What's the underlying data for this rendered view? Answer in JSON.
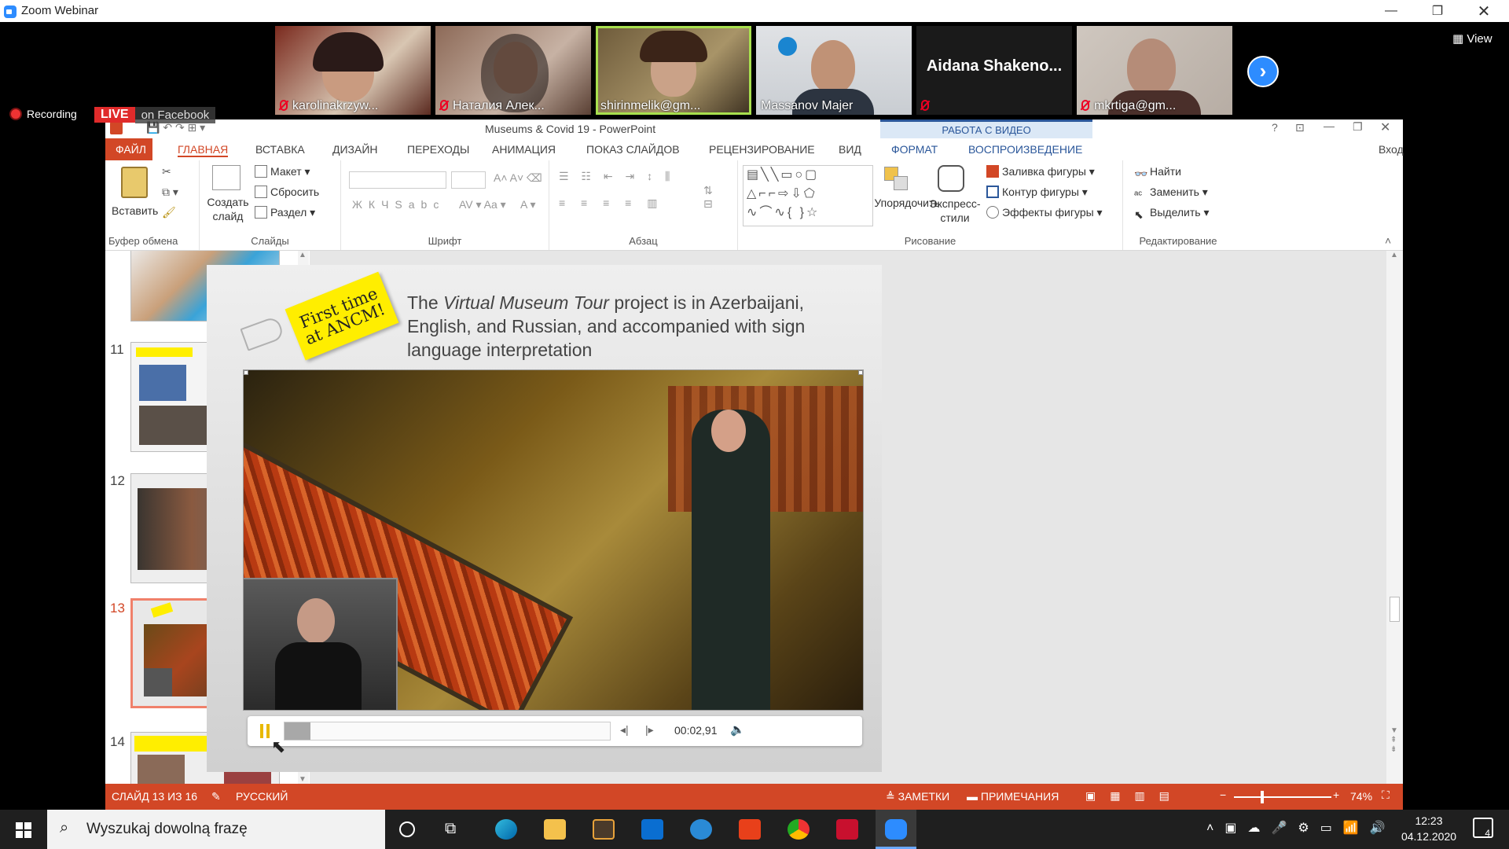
{
  "zoom": {
    "title": "Zoom Webinar",
    "participants": [
      {
        "name": "karolinakrzyw..."
      },
      {
        "name": "Наталия Алек..."
      },
      {
        "name": "shirinmelik@gm..."
      },
      {
        "name": "Massanov Majer"
      },
      {
        "name": "Aidana Shakeno..."
      },
      {
        "name": "mkrtiga@gm..."
      }
    ],
    "view_label": "View",
    "recording_label": "Recording",
    "live_label": "LIVE",
    "live_platform": "on Facebook"
  },
  "ppt": {
    "title": "Museums & Covid 19 - PowerPoint",
    "context_tab_group": "РАБОТА С ВИДЕО",
    "tabs": [
      "ФАЙЛ",
      "ГЛАВНАЯ",
      "ВСТАВКА",
      "ДИЗАЙН",
      "ПЕРЕХОДЫ",
      "АНИМАЦИЯ",
      "ПОКАЗ СЛАЙДОВ",
      "РЕЦЕНЗИРОВАНИЕ",
      "ВИД",
      "ФОРМАТ",
      "ВОСПРОИЗВЕДЕНИЕ"
    ],
    "signin": "Вход",
    "ribbon": {
      "clipboard": {
        "paste": "Вставить",
        "label": "Буфер обмена"
      },
      "slides": {
        "new_slide": "Создать слайд",
        "layout": "Макет",
        "reset": "Сбросить",
        "section": "Раздел",
        "label": "Слайды"
      },
      "font": {
        "label": "Шрифт"
      },
      "paragraph": {
        "label": "Абзац"
      },
      "drawing": {
        "arrange": "Упорядочить",
        "quick_styles": "Экспресс-стили",
        "fill": "Заливка фигуры",
        "outline": "Контур фигуры",
        "effects": "Эффекты фигуры",
        "label": "Рисование"
      },
      "editing": {
        "find": "Найти",
        "replace": "Заменить",
        "select": "Выделить",
        "label": "Редактирование"
      }
    },
    "slide_numbers": [
      "11",
      "12",
      "13",
      "14"
    ],
    "slide": {
      "badge": "First time at ANCM!",
      "text_pre": "The ",
      "text_em": "Virtual Museum Tour",
      "text_post": " project is in Azerbaijani, English, and Russian, and accompanied with sign language interpretation",
      "video_time": "00:02,91",
      "video_progress": 0.08
    },
    "status": {
      "slide_info": "СЛАЙД 13 ИЗ 16",
      "language": "РУССКИЙ",
      "notes": "ЗАМЕТКИ",
      "comments": "ПРИМЕЧАНИЯ",
      "zoom": "74%"
    }
  },
  "taskbar": {
    "search_placeholder": "Wyszukaj dowolną frazę",
    "time": "12:23",
    "date": "04.12.2020",
    "notifications": "4"
  }
}
